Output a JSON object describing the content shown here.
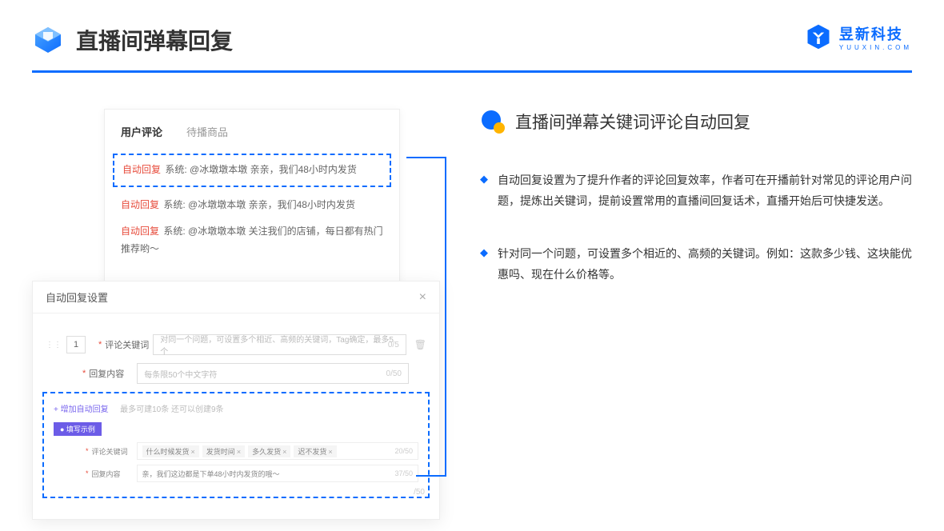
{
  "header": {
    "title": "直播间弹幕回复"
  },
  "brand": {
    "name": "昱新科技",
    "url": "YUUXIN.COM"
  },
  "comments": {
    "tabs": {
      "active": "用户评论",
      "inactive": "待播商品"
    },
    "row1_tag": "自动回复",
    "row1_label": "系统:",
    "row1_text": "@冰墩墩本墩 亲亲，我们48小时内发货",
    "row2_tag": "自动回复",
    "row2_label": "系统:",
    "row2_text": "@冰墩墩本墩 亲亲，我们48小时内发货",
    "row3_tag": "自动回复",
    "row3_label": "系统:",
    "row3_text": "@冰墩墩本墩 关注我们的店铺，每日都有热门推荐哟～"
  },
  "modal": {
    "title": "自动回复设置",
    "num": "1",
    "kw_label": "评论关键词",
    "kw_placeholder": "对同一个问题，可设置多个相近、高频的关键词，Tag确定，最多5个",
    "kw_counter": "0/5",
    "content_label": "回复内容",
    "content_placeholder": "每条限50个中文字符",
    "content_counter": "0/50",
    "add_link": "+ 增加自动回复",
    "add_hint": "最多可建10条 还可以创建9条",
    "example_tag": "● 填写示例",
    "ex_kw_label": "评论关键词",
    "ex_content_label": "回复内容",
    "chip1": "什么时候发货",
    "chip2": "发货时间",
    "chip3": "多久发货",
    "chip4": "迟不发货",
    "ex_kw_counter": "20/50",
    "ex_content_text": "亲，我们这边都是下单48小时内发货的哦～",
    "ex_content_counter": "37/50",
    "side_counter": "/50"
  },
  "right": {
    "section_title": "直播间弹幕关键词评论自动回复",
    "bullet1": "自动回复设置为了提升作者的评论回复效率，作者可在开播前针对常见的评论用户问题，提炼出关键词，提前设置常用的直播间回复话术，直播开始后可快捷发送。",
    "bullet2": "针对同一个问题，可设置多个相近的、高频的关键词。例如：这款多少钱、这块能优惠吗、现在什么价格等。"
  }
}
